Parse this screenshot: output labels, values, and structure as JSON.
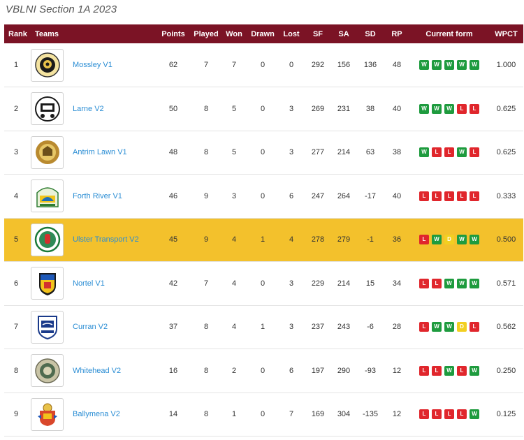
{
  "title": "VBLNI Section 1A 2023",
  "headers": {
    "rank": "Rank",
    "teams": "Teams",
    "points": "Points",
    "played": "Played",
    "won": "Won",
    "drawn": "Drawn",
    "lost": "Lost",
    "sf": "SF",
    "sa": "SA",
    "sd": "SD",
    "rp": "RP",
    "form": "Current form",
    "wpct": "WPCT"
  },
  "colors": {
    "header": "#7b1325",
    "highlight": "#f3c12c",
    "win": "#1e9b3e",
    "loss": "#e0262c",
    "draw": "#f2cf21",
    "link": "#2a8dd4"
  },
  "rows": [
    {
      "rank": "1",
      "team": "Mossley V1",
      "logo": "mossley-logo",
      "points": "62",
      "played": "7",
      "won": "7",
      "drawn": "0",
      "lost": "0",
      "sf": "292",
      "sa": "156",
      "sd": "136",
      "rp": "48",
      "form": [
        "W",
        "W",
        "W",
        "W",
        "W"
      ],
      "wpct": "1.000",
      "highlight": false
    },
    {
      "rank": "2",
      "team": "Larne V2",
      "logo": "larne-logo",
      "points": "50",
      "played": "8",
      "won": "5",
      "drawn": "0",
      "lost": "3",
      "sf": "269",
      "sa": "231",
      "sd": "38",
      "rp": "40",
      "form": [
        "W",
        "W",
        "W",
        "L",
        "L"
      ],
      "wpct": "0.625",
      "highlight": false
    },
    {
      "rank": "3",
      "team": "Antrim Lawn V1",
      "logo": "antrim-lawn-logo",
      "points": "48",
      "played": "8",
      "won": "5",
      "drawn": "0",
      "lost": "3",
      "sf": "277",
      "sa": "214",
      "sd": "63",
      "rp": "38",
      "form": [
        "W",
        "L",
        "L",
        "W",
        "L"
      ],
      "wpct": "0.625",
      "highlight": false
    },
    {
      "rank": "4",
      "team": "Forth River V1",
      "logo": "forth-river-logo",
      "points": "46",
      "played": "9",
      "won": "3",
      "drawn": "0",
      "lost": "6",
      "sf": "247",
      "sa": "264",
      "sd": "-17",
      "rp": "40",
      "form": [
        "L",
        "L",
        "L",
        "L",
        "L"
      ],
      "wpct": "0.333",
      "highlight": false
    },
    {
      "rank": "5",
      "team": "Ulster Transport V2",
      "logo": "ulster-transport-logo",
      "points": "45",
      "played": "9",
      "won": "4",
      "drawn": "1",
      "lost": "4",
      "sf": "278",
      "sa": "279",
      "sd": "-1",
      "rp": "36",
      "form": [
        "L",
        "W",
        "D",
        "W",
        "W"
      ],
      "wpct": "0.500",
      "highlight": true
    },
    {
      "rank": "6",
      "team": "Nortel V1",
      "logo": "nortel-logo",
      "points": "42",
      "played": "7",
      "won": "4",
      "drawn": "0",
      "lost": "3",
      "sf": "229",
      "sa": "214",
      "sd": "15",
      "rp": "34",
      "form": [
        "L",
        "L",
        "W",
        "W",
        "W"
      ],
      "wpct": "0.571",
      "highlight": false
    },
    {
      "rank": "7",
      "team": "Curran V2",
      "logo": "curran-logo",
      "points": "37",
      "played": "8",
      "won": "4",
      "drawn": "1",
      "lost": "3",
      "sf": "237",
      "sa": "243",
      "sd": "-6",
      "rp": "28",
      "form": [
        "L",
        "W",
        "W",
        "D",
        "L"
      ],
      "wpct": "0.562",
      "highlight": false
    },
    {
      "rank": "8",
      "team": "Whitehead V2",
      "logo": "whitehead-logo",
      "points": "16",
      "played": "8",
      "won": "2",
      "drawn": "0",
      "lost": "6",
      "sf": "197",
      "sa": "290",
      "sd": "-93",
      "rp": "12",
      "form": [
        "L",
        "L",
        "W",
        "L",
        "W"
      ],
      "wpct": "0.250",
      "highlight": false
    },
    {
      "rank": "9",
      "team": "Ballymena V2",
      "logo": "ballymena-logo",
      "points": "14",
      "played": "8",
      "won": "1",
      "drawn": "0",
      "lost": "7",
      "sf": "169",
      "sa": "304",
      "sd": "-135",
      "rp": "12",
      "form": [
        "L",
        "L",
        "L",
        "L",
        "W"
      ],
      "wpct": "0.125",
      "highlight": false
    }
  ]
}
